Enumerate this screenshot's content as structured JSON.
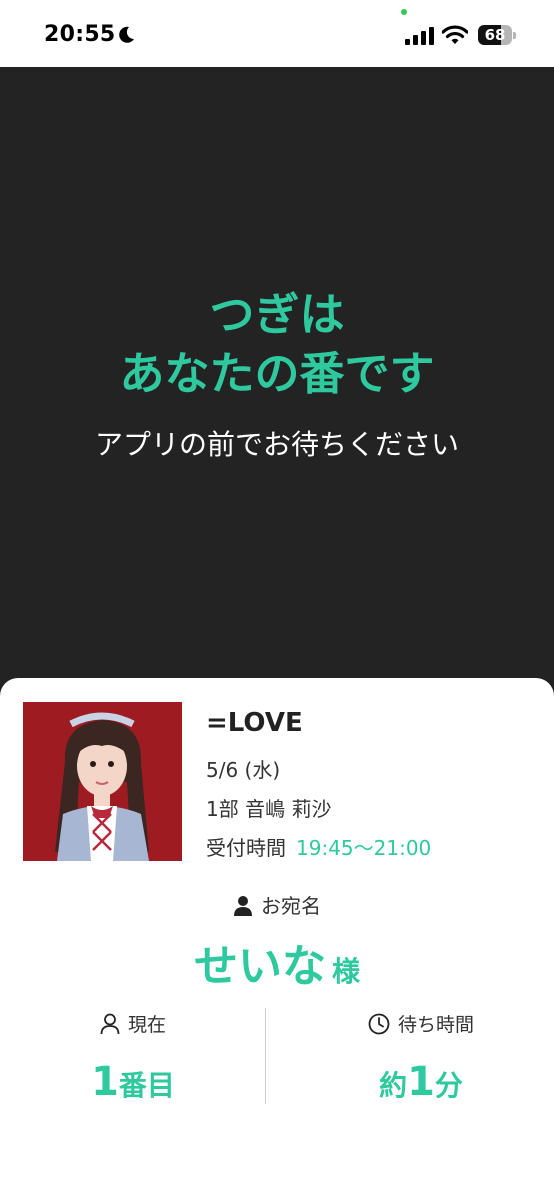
{
  "status_bar": {
    "time": "20:55",
    "battery_level": 68,
    "battery_label": "68"
  },
  "hero": {
    "title_line1": "つぎは",
    "title_line2": "あなたの番です",
    "subtitle": "アプリの前でお待ちください"
  },
  "event": {
    "group": "=LOVE",
    "date": "5/6 (水)",
    "member": "1部  音嶋 莉沙",
    "reception_label": "受付時間",
    "reception_time": "19:45〜21:00"
  },
  "addressee": {
    "label": "お宛名",
    "name": "せいな",
    "honorific": "様"
  },
  "queue": {
    "current_label": "現在",
    "current_number": "1",
    "current_unit": "番目",
    "wait_label": "待ち時間",
    "wait_prefix": "約",
    "wait_number": "1",
    "wait_unit": "分"
  },
  "colors": {
    "accent": "#2ec99e",
    "hero_background": "#232323",
    "photo_background": "#9e1b22"
  }
}
